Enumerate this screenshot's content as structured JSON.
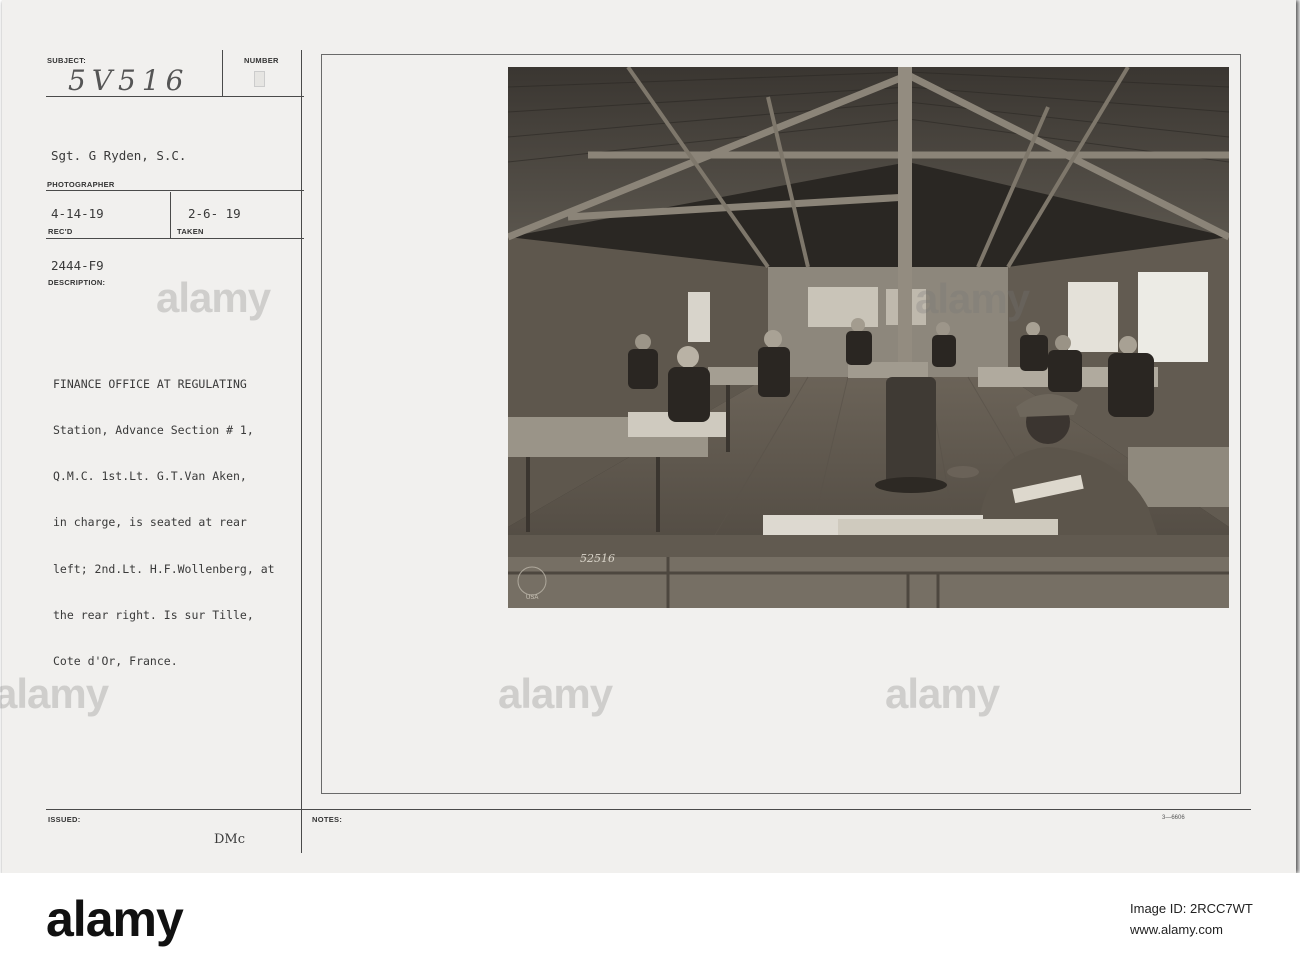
{
  "card": {
    "labels": {
      "subject": "SUBJECT:",
      "number": "NUMBER",
      "photographer": "PHOTOGRAPHER",
      "recd": "REC'D",
      "taken": "TAKEN",
      "description": "DESCRIPTION:",
      "issued": "ISSUED:",
      "notes": "NOTES:"
    },
    "subject_number": "5V516",
    "photographer_name": "Sgt. G Ryden, S.C.",
    "recd_date": "4-14-19",
    "taken_date": "2-6- 19",
    "file_code": "2444-F9",
    "description_lines": [
      "FINANCE OFFICE AT REGULATING",
      "Station, Advance Section # 1,",
      "Q.M.C. 1st.Lt. G.T.Van Aken,",
      "in charge, is seated at rear",
      "left; 2nd.Lt. H.F.Wollenberg, at",
      "the rear right. Is sur Tille,",
      "Cote d'Or, France."
    ],
    "issued_by": "DMc",
    "form_number": "3—6606"
  },
  "photo": {
    "negative_number": "52516",
    "stamp": "USA"
  },
  "stock": {
    "watermark": "alamy",
    "logo": "alamy",
    "image_id_label": "Image ID: 2RCC7WT",
    "url": "www.alamy.com"
  }
}
